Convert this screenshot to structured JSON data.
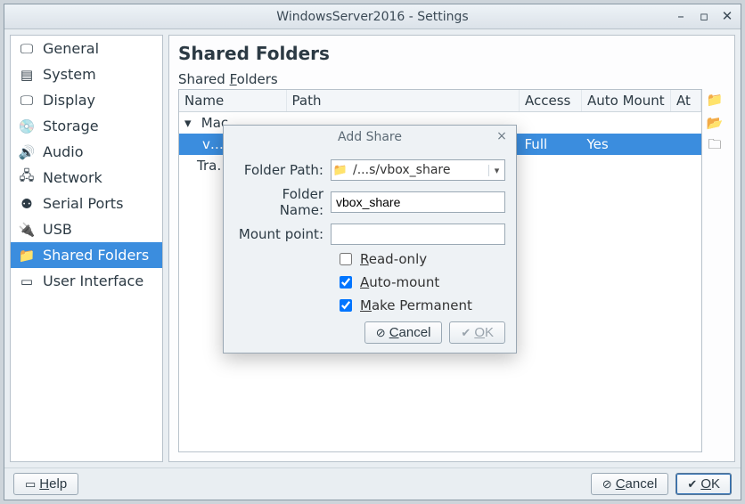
{
  "window": {
    "title": "WindowsServer2016 - Settings"
  },
  "sidebar": {
    "items": [
      {
        "label": "General"
      },
      {
        "label": "System"
      },
      {
        "label": "Display"
      },
      {
        "label": "Storage"
      },
      {
        "label": "Audio"
      },
      {
        "label": "Network"
      },
      {
        "label": "Serial Ports"
      },
      {
        "label": "USB"
      },
      {
        "label": "Shared Folders"
      },
      {
        "label": "User Interface"
      }
    ]
  },
  "main": {
    "heading": "Shared Folders",
    "section_label": "Shared Folders",
    "columns": [
      "Name",
      "Path",
      "Access",
      "Auto Mount",
      "At"
    ],
    "rows": {
      "group_machine": "Machine Folders",
      "selected": {
        "name": "vbox_share",
        "path": "",
        "access": "Full",
        "auto_mount": "Yes",
        "at": ""
      },
      "group_transient": "Transient Folders"
    }
  },
  "dialog": {
    "title": "Add Share",
    "labels": {
      "path": "Folder Path:",
      "name": "Folder Name:",
      "mount": "Mount point:",
      "readonly": "Read-only",
      "automount": "Auto-mount",
      "permanent": "Make Permanent"
    },
    "values": {
      "path": "/...s/vbox_share",
      "name": "vbox_share",
      "mount": ""
    },
    "checks": {
      "readonly": false,
      "automount": true,
      "permanent": true
    },
    "buttons": {
      "cancel": "Cancel",
      "ok": "OK"
    }
  },
  "footer": {
    "help": "Help",
    "cancel": "Cancel",
    "ok": "OK"
  }
}
